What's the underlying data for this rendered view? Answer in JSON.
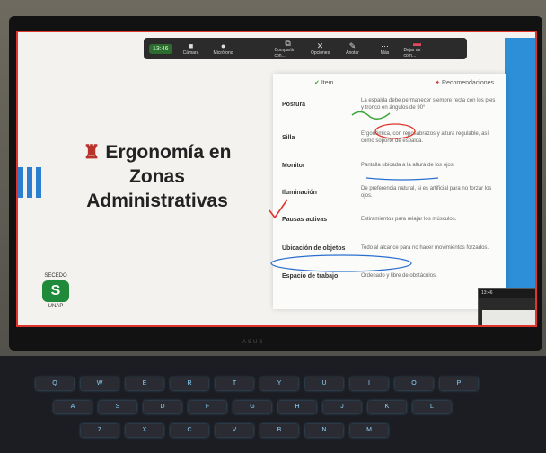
{
  "zoom_bar": {
    "time": "13:46",
    "buttons": [
      {
        "label": "Cámara",
        "icon": "camera-icon",
        "glyph": "■"
      },
      {
        "label": "Micrófono",
        "icon": "microphone-icon",
        "glyph": "●"
      },
      {
        "label": "",
        "icon": "spacer",
        "glyph": ""
      },
      {
        "label": "Compartir con...",
        "icon": "share-icon",
        "glyph": "⧉"
      },
      {
        "label": "Opciones",
        "icon": "options-icon",
        "glyph": "✕"
      },
      {
        "label": "Anotar",
        "icon": "annotate-icon",
        "glyph": "✎"
      },
      {
        "label": "Más",
        "icon": "more-icon",
        "glyph": "⋯"
      },
      {
        "label": "Dejar de com...",
        "icon": "stop-share-icon",
        "glyph": "▬"
      }
    ]
  },
  "slide": {
    "title_lines": [
      "Ergonomía en",
      "Zonas",
      "Administrativas"
    ],
    "logo_top": "SECEDO",
    "logo_mark": "S",
    "logo_bottom": "UNAP",
    "table_header": {
      "left": "Item",
      "right": "Recomendaciones"
    },
    "rows": [
      {
        "item": "Postura",
        "rec": "La espalda debe permanecer siempre recta con los pies y tronco en ángulos de 90°"
      },
      {
        "item": "Silla",
        "rec": "Ergonómica, con reposabrazos y altura regulable, así como soporte de espalda."
      },
      {
        "item": "Monitor",
        "rec": "Pantalla ubicada a la altura de los ojos."
      },
      {
        "item": "Iluminación",
        "rec": "De preferencia natural, si es artificial para no forzar los ojos."
      },
      {
        "item": "Pausas activas",
        "rec": "Estiramientos para relajar los músculos."
      },
      {
        "item": "Ubicación de objetos",
        "rec": "Todo al alcance para no hacer movimientos forzados."
      },
      {
        "item": "Espacio de trabajo",
        "rec": "Ordenado y libre de obstáculos."
      }
    ]
  },
  "mini_window": {
    "title": "13:46"
  },
  "laptop_brand": "ASUS",
  "keyboard_keys": [
    "Q",
    "W",
    "E",
    "R",
    "T",
    "Y",
    "U",
    "I",
    "O",
    "P",
    "A",
    "S",
    "D",
    "F",
    "G",
    "H",
    "J",
    "K",
    "L",
    "Z",
    "X",
    "C",
    "V",
    "B",
    "N",
    "M"
  ],
  "colors": {
    "accent_blue": "#2d8fd8",
    "screen_border": "#e0342c",
    "logo_green": "#1f8a3a",
    "chair_red": "#b8322a"
  }
}
